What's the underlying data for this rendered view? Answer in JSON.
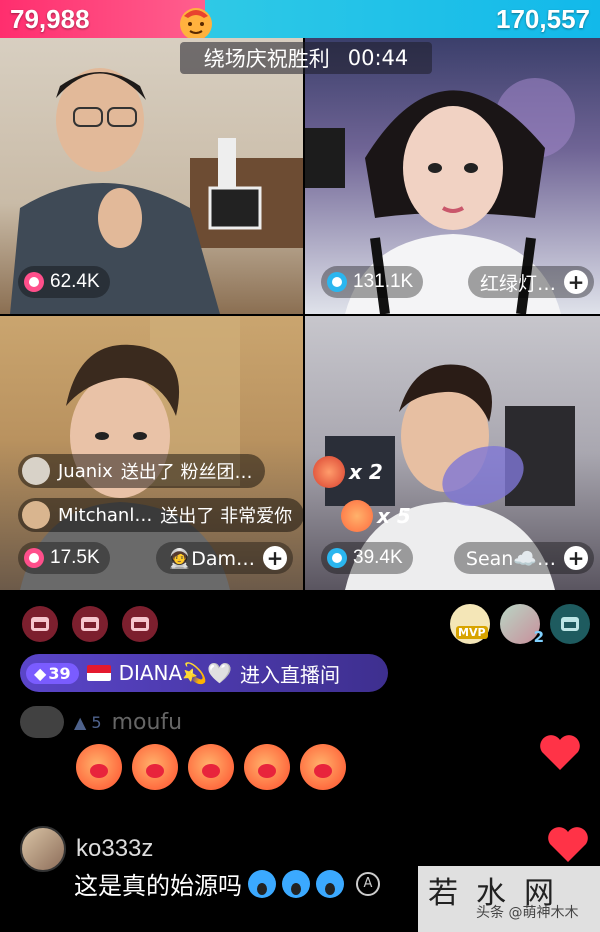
{
  "pk": {
    "left_score": "79,988",
    "right_score": "170,557",
    "timer_label": "绕场庆祝胜利",
    "timer_value": "00:44",
    "left_color": "#ff2e6e",
    "right_color": "#12b9ea"
  },
  "tiles": [
    {
      "likes": "62.4K",
      "icon": "pink-heart-icon"
    },
    {
      "likes": "131.1K",
      "icon": "blue-heart-icon",
      "name": "红绿灯…"
    },
    {
      "likes": "17.5K",
      "icon": "pink-heart-icon",
      "name": "🧑‍🚀Dam…"
    },
    {
      "likes": "39.4K",
      "icon": "blue-heart-icon",
      "name": "Sean☁️…"
    }
  ],
  "gift_notices": [
    {
      "user": "Juanix",
      "text": "送出了 粉丝团…"
    },
    {
      "user": "Mitchanl…",
      "text": "送出了 非常爱你"
    }
  ],
  "combos": [
    {
      "count": "x 2"
    },
    {
      "count": "x 5"
    }
  ],
  "mvp_label": "MVP",
  "seat_count": "2",
  "entry": {
    "level": "39",
    "username": "DIANA💫🤍",
    "action": "进入直播间"
  },
  "faded_comment": {
    "level": "5",
    "username": "moufu"
  },
  "chat": {
    "username": "ko333z",
    "message": "这是真的始源吗"
  },
  "watermark": {
    "brand": "若水网",
    "author": "头条 @萌神木木"
  }
}
